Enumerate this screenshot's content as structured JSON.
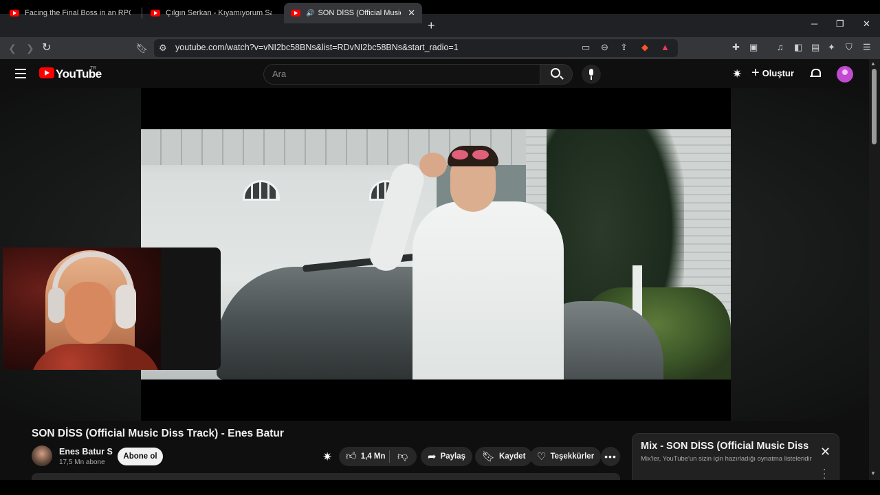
{
  "browser": {
    "tabs": [
      {
        "title": "Facing the Final Boss in an RPG - You",
        "active": false
      },
      {
        "title": "Çılgın Serkan - Kıyamıyorum Sana | D",
        "active": false
      },
      {
        "title": "SON DİSS (Official Music Diss",
        "active": true,
        "playing_audio": true
      }
    ],
    "url": "youtube.com/watch?v=vNI2bc58BNs&list=RDvNI2bc58BNs&start_radio=1"
  },
  "masthead": {
    "logo_text": "YouTube",
    "country_code": "TR",
    "search_placeholder": "Ara",
    "create_label": "Oluştur"
  },
  "video": {
    "title": "SON DİSS (Official Music Diss Track) - Enes Batur",
    "channel_name": "Enes Batur S",
    "subscriber_count": "17,5 Mn abone",
    "subscribe_label": "Abone ol",
    "like_count": "1,4 Mn",
    "share_label": "Paylaş",
    "save_label": "Kaydet",
    "thanks_label": "Teşekkürler"
  },
  "mix": {
    "title": "Mix - SON DİSS (Official Music Diss Track) - Enes Batur",
    "subtitle": "Mix'ler, YouTube'un sizin için hazırladığı oynatma listeleridir"
  }
}
